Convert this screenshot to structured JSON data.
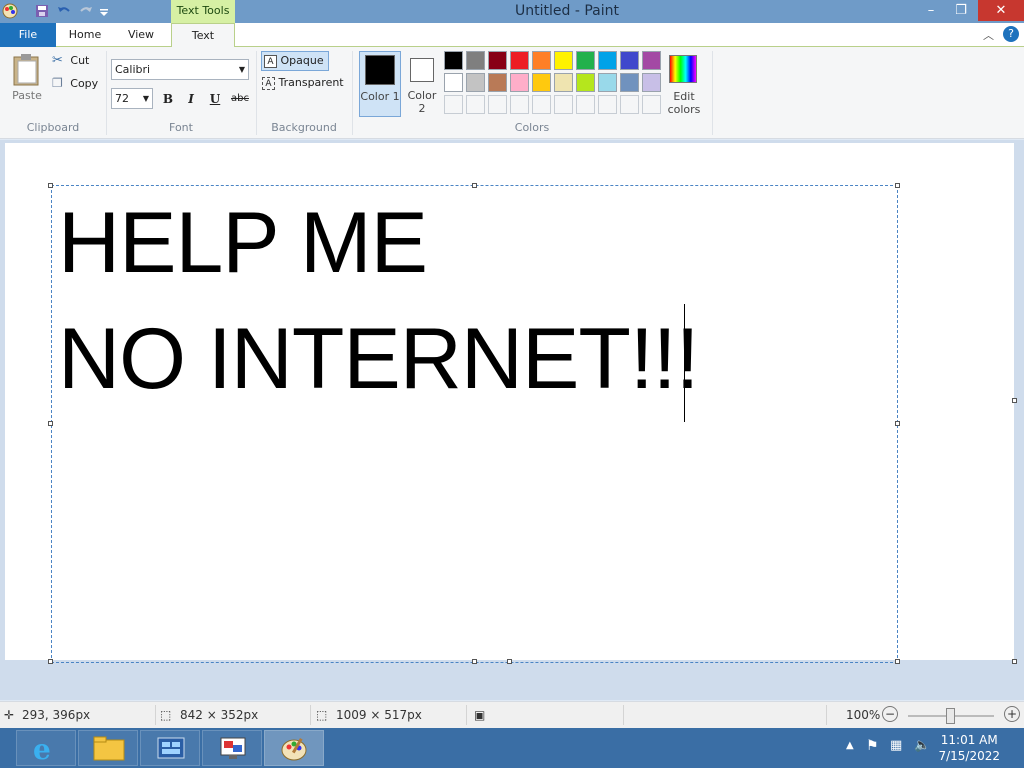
{
  "window": {
    "title": "Untitled - Paint",
    "context_tab": "Text Tools",
    "controls": {
      "minimize": "–",
      "maximize": "❐",
      "close": "✕"
    }
  },
  "tabs": {
    "file": "File",
    "home": "Home",
    "view": "View",
    "text": "Text"
  },
  "ribbon": {
    "clipboard": {
      "label": "Clipboard",
      "paste": "Paste",
      "cut": "Cut",
      "copy": "Copy"
    },
    "font": {
      "label": "Font",
      "family": "Calibri",
      "size": "72",
      "bold": "B",
      "italic": "I",
      "underline": "U",
      "strike": "abc"
    },
    "background": {
      "label": "Background",
      "opaque": "Opaque",
      "transparent": "Transparent"
    },
    "colors": {
      "label": "Colors",
      "color1": "Color 1",
      "color2": "Color 2",
      "edit": "Edit colors",
      "color1_value": "#000000",
      "color2_value": "#ffffff",
      "row1": [
        "#000000",
        "#7f7f7f",
        "#880015",
        "#ed1c24",
        "#ff7f27",
        "#fff200",
        "#22b14c",
        "#00a2e8",
        "#3f48cc",
        "#a349a4"
      ],
      "row2": [
        "#ffffff",
        "#c3c3c3",
        "#b97a57",
        "#ffaec9",
        "#ffc90e",
        "#efe4b0",
        "#b5e61d",
        "#99d9ea",
        "#7092be",
        "#c8bfe7"
      ]
    }
  },
  "canvas": {
    "lines": [
      "HELP ME",
      "NO INTERNET!!!"
    ]
  },
  "status": {
    "cursor": "293, 396px",
    "selection": "842 × 352px",
    "size": "1009 × 517px",
    "zoom": "100%"
  },
  "taskbar": {
    "time": "11:01 AM",
    "date": "7/15/2022"
  }
}
